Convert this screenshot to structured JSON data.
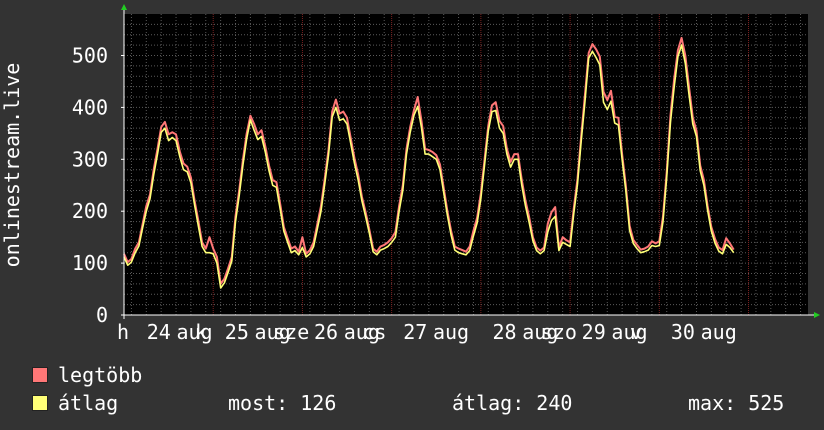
{
  "chart_data": {
    "type": "line",
    "ylabel": "onlinestream.live",
    "ylim": [
      0,
      580
    ],
    "yticks": [
      0,
      100,
      200,
      300,
      400,
      500
    ],
    "xlim": [
      0,
      184
    ],
    "xtick_labels": [
      {
        "x": 0,
        "text": "h"
      },
      {
        "x": 8,
        "text": "24"
      },
      {
        "x": 16,
        "text": "aug"
      },
      {
        "x": 21,
        "text": "k"
      },
      {
        "x": 29,
        "text": "25"
      },
      {
        "x": 37,
        "text": "aug"
      },
      {
        "x": 42,
        "text": "sze"
      },
      {
        "x": 53,
        "text": "26"
      },
      {
        "x": 61,
        "text": "aug"
      },
      {
        "x": 66,
        "text": "cs"
      },
      {
        "x": 77,
        "text": "27"
      },
      {
        "x": 85,
        "text": "aug"
      },
      {
        "x": 101,
        "text": "28"
      },
      {
        "x": 109,
        "text": "aug"
      },
      {
        "x": 114,
        "text": "szo"
      },
      {
        "x": 125,
        "text": "29"
      },
      {
        "x": 133,
        "text": "aug"
      },
      {
        "x": 138,
        "text": "v"
      },
      {
        "x": 149,
        "text": "30"
      },
      {
        "x": 157,
        "text": "aug"
      }
    ],
    "day_lines_x": [
      24,
      48,
      72,
      96,
      120,
      144,
      168
    ],
    "colors": {
      "background": "#333333",
      "plot_bg": "#000000",
      "grid": "#5a5a5a",
      "day_line": "#7a2020",
      "axis": "#ffffff",
      "arrow": "#22cc22"
    },
    "series": [
      {
        "name": "legtöbb",
        "color": "#ff7777",
        "values": [
          118,
          102,
          108,
          128,
          140,
          175,
          210,
          232,
          280,
          320,
          362,
          372,
          348,
          352,
          348,
          315,
          292,
          286,
          265,
          220,
          182,
          140,
          128,
          150,
          128,
          112,
          60,
          70,
          90,
          112,
          190,
          240,
          300,
          350,
          384,
          368,
          348,
          356,
          325,
          288,
          260,
          256,
          215,
          170,
          148,
          128,
          132,
          122,
          150,
          118,
          125,
          140,
          175,
          210,
          262,
          318,
          392,
          415,
          388,
          392,
          380,
          340,
          302,
          270,
          228,
          198,
          165,
          128,
          122,
          132,
          135,
          140,
          148,
          160,
          210,
          250,
          320,
          362,
          395,
          420,
          375,
          320,
          318,
          314,
          308,
          290,
          245,
          200,
          162,
          132,
          128,
          125,
          122,
          132,
          162,
          188,
          235,
          300,
          365,
          404,
          410,
          374,
          364,
          320,
          295,
          310,
          310,
          260,
          220,
          188,
          150,
          130,
          124,
          130,
          176,
          198,
          208,
          130,
          150,
          144,
          140,
          206,
          262,
          345,
          425,
          505,
          522,
          512,
          498,
          430,
          414,
          432,
          382,
          380,
          310,
          250,
          172,
          145,
          135,
          126,
          128,
          132,
          142,
          138,
          142,
          190,
          275,
          385,
          455,
          510,
          534,
          500,
          440,
          380,
          355,
          288,
          260,
          210,
          170,
          146,
          130,
          125,
          148,
          138,
          126
        ]
      },
      {
        "name": "átlag",
        "color": "#ffff77",
        "values": [
          112,
          96,
          102,
          120,
          133,
          168,
          200,
          224,
          270,
          310,
          352,
          360,
          336,
          342,
          336,
          305,
          280,
          276,
          255,
          212,
          172,
          132,
          120,
          120,
          118,
          100,
          52,
          62,
          82,
          104,
          180,
          230,
          290,
          340,
          376,
          356,
          338,
          344,
          314,
          278,
          250,
          246,
          205,
          162,
          140,
          120,
          124,
          116,
          130,
          112,
          118,
          132,
          166,
          200,
          252,
          308,
          382,
          400,
          375,
          378,
          368,
          330,
          292,
          260,
          220,
          190,
          158,
          122,
          116,
          125,
          128,
          132,
          140,
          150,
          200,
          240,
          310,
          352,
          385,
          402,
          362,
          310,
          310,
          305,
          300,
          280,
          236,
          192,
          154,
          125,
          120,
          118,
          116,
          124,
          152,
          178,
          225,
          290,
          355,
          392,
          394,
          360,
          350,
          310,
          285,
          300,
          300,
          250,
          210,
          178,
          143,
          124,
          118,
          124,
          160,
          182,
          190,
          124,
          140,
          136,
          132,
          196,
          252,
          335,
          412,
          495,
          508,
          496,
          482,
          410,
          396,
          412,
          370,
          366,
          300,
          240,
          163,
          138,
          128,
          120,
          122,
          125,
          134,
          132,
          134,
          180,
          265,
          372,
          440,
          498,
          520,
          485,
          425,
          368,
          344,
          278,
          250,
          202,
          162,
          138,
          123,
          118,
          136,
          130,
          120
        ]
      }
    ]
  },
  "legend": {
    "items": [
      {
        "label": "legtöbb",
        "color": "#ff7777"
      },
      {
        "label": "átlag",
        "color": "#ffff77"
      }
    ]
  },
  "stats": {
    "most": "most: 126",
    "atlag": "átlag: 240",
    "max": "max: 525"
  }
}
